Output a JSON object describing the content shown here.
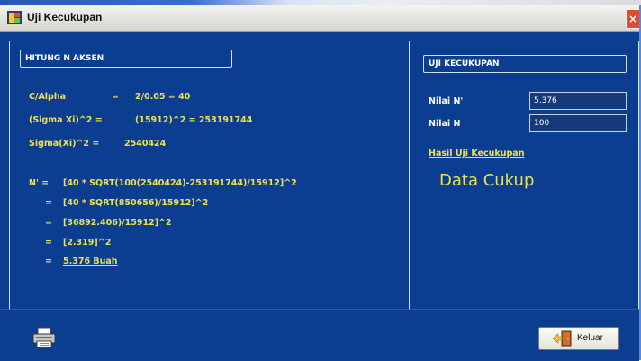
{
  "window": {
    "title": "Uji Kecukupan",
    "close_glyph": "×"
  },
  "left_panel": {
    "header": "HITUNG N AKSEN",
    "lines": [
      {
        "label": "C/Alpha",
        "eq": "=",
        "value": "2/0.05 = 40"
      },
      {
        "label": "(Sigma Xi)^2 =",
        "value": "(15912)^2  = 253191744"
      },
      {
        "label": "Sigma(Xi)^2 =",
        "value": "2540424"
      }
    ],
    "formula": {
      "prefix": "N' =",
      "line1": "[40 * SQRT(100(2540424)-253191744)/15912]^2",
      "line2": "[40 * SQRT(850656)/15912]^2",
      "line3": "[36892.406)/15912]^2",
      "line4": "[2.319]^2",
      "result": "5.376 Buah",
      "eq": "="
    }
  },
  "right_panel": {
    "header": "UJI KECUKUPAN",
    "nilai_n_aksen_label": "Nilai N'",
    "nilai_n_aksen_value": "5.376",
    "nilai_n_label": "Nilai N",
    "nilai_n_value": "100",
    "hasil_label": "Hasil Uji Kecukupan",
    "hasil_value": "Data Cukup"
  },
  "bottom": {
    "exit_label": "Keluar"
  },
  "icons": [
    "app-icon",
    "close-icon",
    "printer-icon",
    "exit-door-icon"
  ],
  "colors": {
    "background": "#0b3d91",
    "label_yellow": "#f0e24a",
    "text_white": "#ffffff"
  }
}
